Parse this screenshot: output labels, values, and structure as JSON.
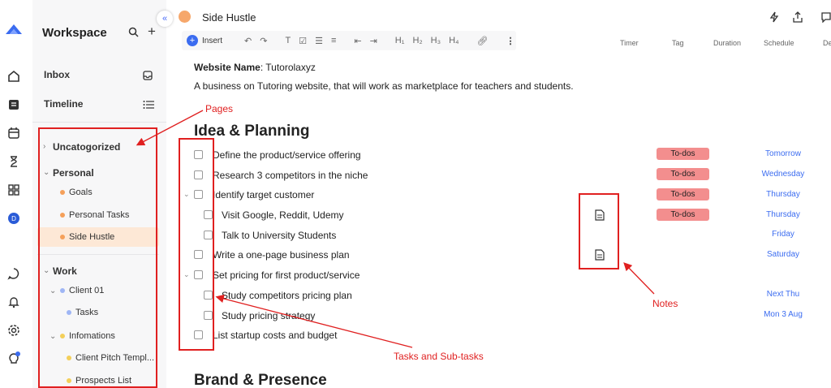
{
  "sidebar": {
    "workspace_title": "Workspace",
    "inbox_label": "Inbox",
    "timeline_label": "Timeline",
    "tree": {
      "uncategorized": "Uncatogorized",
      "personal": "Personal",
      "goals": "Goals",
      "personal_tasks": "Personal Tasks",
      "side_hustle": "Side Hustle",
      "work": "Work",
      "client01": "Client 01",
      "tasks": "Tasks",
      "infomations": "Infomations",
      "client_pitch": "Client Pitch Templ...",
      "prospects": "Prospects List"
    }
  },
  "doc": {
    "title": "Side Hustle",
    "toolbar": {
      "insert": "Insert",
      "h1": "H₁",
      "h2": "H₂",
      "h3": "H₃",
      "h4": "H₄"
    },
    "columns": [
      "Timer",
      "Tag",
      "Duration",
      "Schedule",
      "De"
    ],
    "website_label": "Website Name",
    "website_value": ": Tutorolaxyz",
    "description": "A business on Tutoring website, that will work as marketplace for teachers and students.",
    "section1": "Idea & Planning",
    "section2": "Brand & Presence",
    "tasks": [
      {
        "text": "Define the product/service offering",
        "tag": "To-dos",
        "schedule": "Tomorrow"
      },
      {
        "text": "Research 3 competitors in the niche",
        "tag": "To-dos",
        "schedule": "Wednesday"
      },
      {
        "text": "Identify target customer",
        "tag": "To-dos",
        "schedule": "Thursday"
      },
      {
        "text": "Visit Google, Reddit, Udemy",
        "tag": "To-dos",
        "schedule": "Thursday"
      },
      {
        "text": "Talk to University Students",
        "tag": "",
        "schedule": "Friday"
      },
      {
        "text": "Write a one-page business plan",
        "tag": "",
        "schedule": "Saturday"
      },
      {
        "text": "Set pricing for first product/service",
        "tag": "",
        "schedule": ""
      },
      {
        "text": "Study competitors pricing plan",
        "tag": "",
        "schedule": "Next Thu"
      },
      {
        "text": "Study pricing strategy",
        "tag": "",
        "schedule": "Mon 3 Aug"
      },
      {
        "text": "List startup costs and budget",
        "tag": "",
        "schedule": ""
      }
    ]
  },
  "annotations": {
    "pages": "Pages",
    "notes": "Notes",
    "tasks": "Tasks and Sub-tasks"
  },
  "colors": {
    "accent": "#3b6cf0",
    "tag_bg": "#f38e8e",
    "annotation": "#e02020",
    "doc_dot": "#f6a76b"
  }
}
